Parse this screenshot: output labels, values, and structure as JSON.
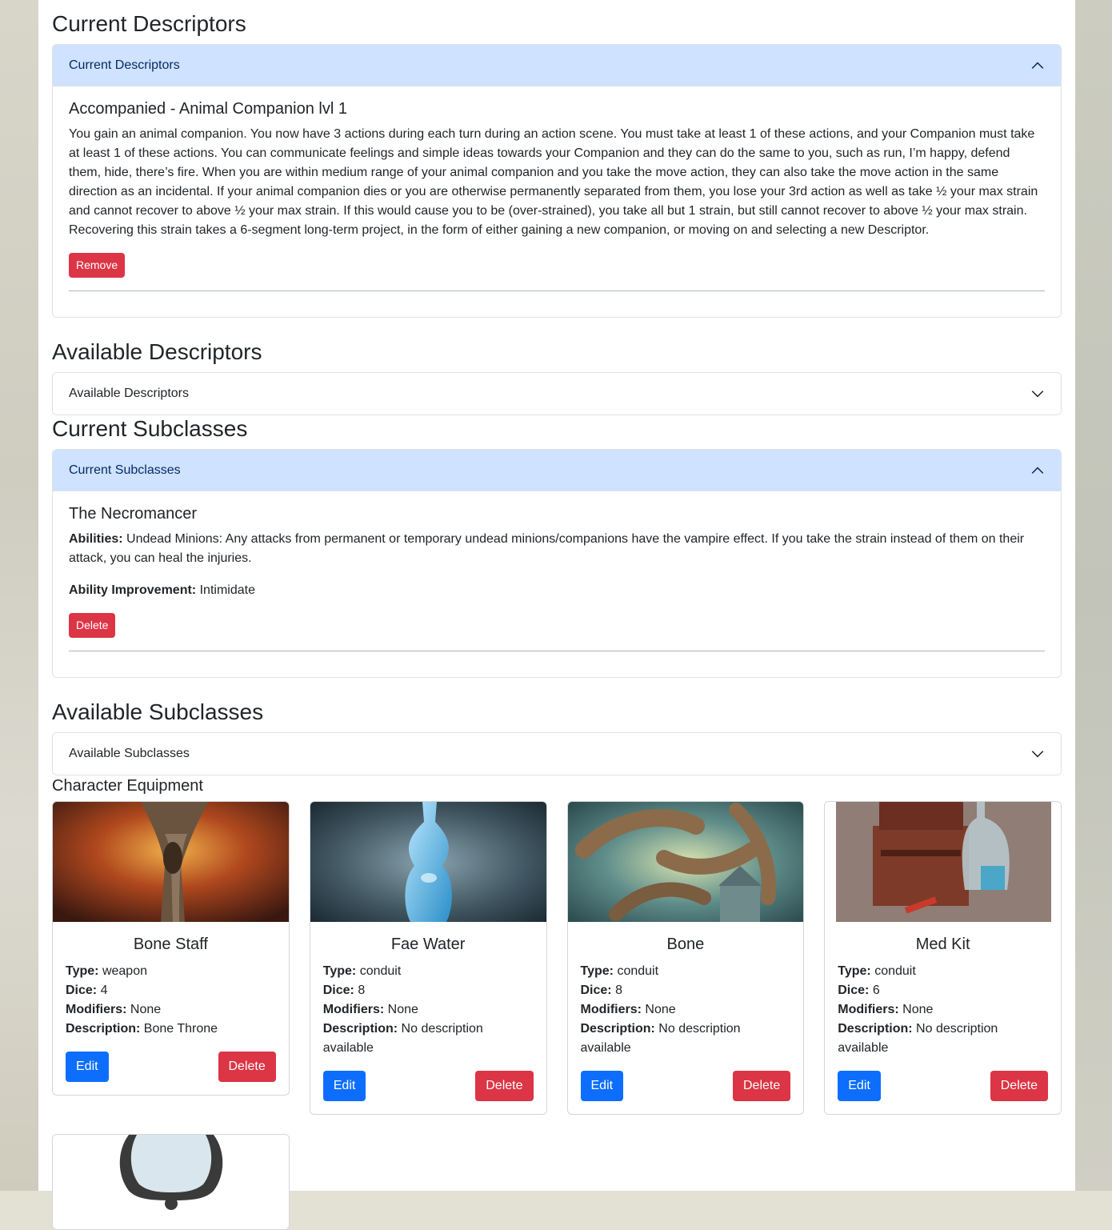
{
  "current_descriptors": {
    "section_title": "Current Descriptors",
    "accordion_label": "Current Descriptors",
    "items": [
      {
        "title": "Accompanied - Animal Companion lvl 1",
        "description": "You gain an animal companion. You now have 3 actions during each turn during an action scene. You must take at least 1 of these actions, and your Companion must take at least 1 of these actions. You can communicate feelings and simple ideas towards your Companion and they can do the same to you, such as run, I’m happy, defend them, hide, there’s fire. When you are within medium range of your animal companion and you take the move action, they can also take the move action in the same direction as an incidental. If your animal companion dies or you are otherwise permanently separated from them, you lose your 3rd action as well as take ½ your max strain and cannot recover to above ½ your max strain. If this would cause you to be (over-strained), you take all but 1 strain, but still cannot recover to above ½ your max strain. Recovering this strain takes a 6-segment long-term project, in the form of either gaining a new companion, or moving on and selecting a new Descriptor.",
        "remove_label": "Remove"
      }
    ]
  },
  "available_descriptors": {
    "section_title": "Available Descriptors",
    "accordion_label": "Available Descriptors"
  },
  "current_subclasses": {
    "section_title": "Current Subclasses",
    "accordion_label": "Current Subclasses",
    "items": [
      {
        "title": "The Necromancer",
        "abilities_label": "Abilities:",
        "abilities": "Undead Minions: Any attacks from permanent or temporary undead minions/companions have the vampire effect. If you take the strain instead of them on their attack, you can heal the injuries.",
        "improvement_label": "Ability Improvement:",
        "improvement": "Intimidate",
        "delete_label": "Delete"
      }
    ]
  },
  "available_subclasses": {
    "section_title": "Available Subclasses",
    "accordion_label": "Available Subclasses"
  },
  "equipment": {
    "section_title": "Character Equipment",
    "labels": {
      "type": "Type:",
      "dice": "Dice:",
      "modifiers": "Modifiers:",
      "description": "Description:"
    },
    "edit_label": "Edit",
    "delete_label": "Delete",
    "items": [
      {
        "name": "Bone Staff",
        "type": "weapon",
        "dice": "4",
        "modifiers": "None",
        "description": "Bone Throne"
      },
      {
        "name": "Fae Water",
        "type": "conduit",
        "dice": "8",
        "modifiers": "None",
        "description": "No description available"
      },
      {
        "name": "Bone",
        "type": "conduit",
        "dice": "8",
        "modifiers": "None",
        "description": "No description available"
      },
      {
        "name": "Med Kit",
        "type": "conduit",
        "dice": "6",
        "modifiers": "None",
        "description": "No description available"
      }
    ]
  },
  "colors": {
    "accent_open_header": "#cfe2ff",
    "danger": "#dc3545",
    "primary": "#0d6efd"
  }
}
